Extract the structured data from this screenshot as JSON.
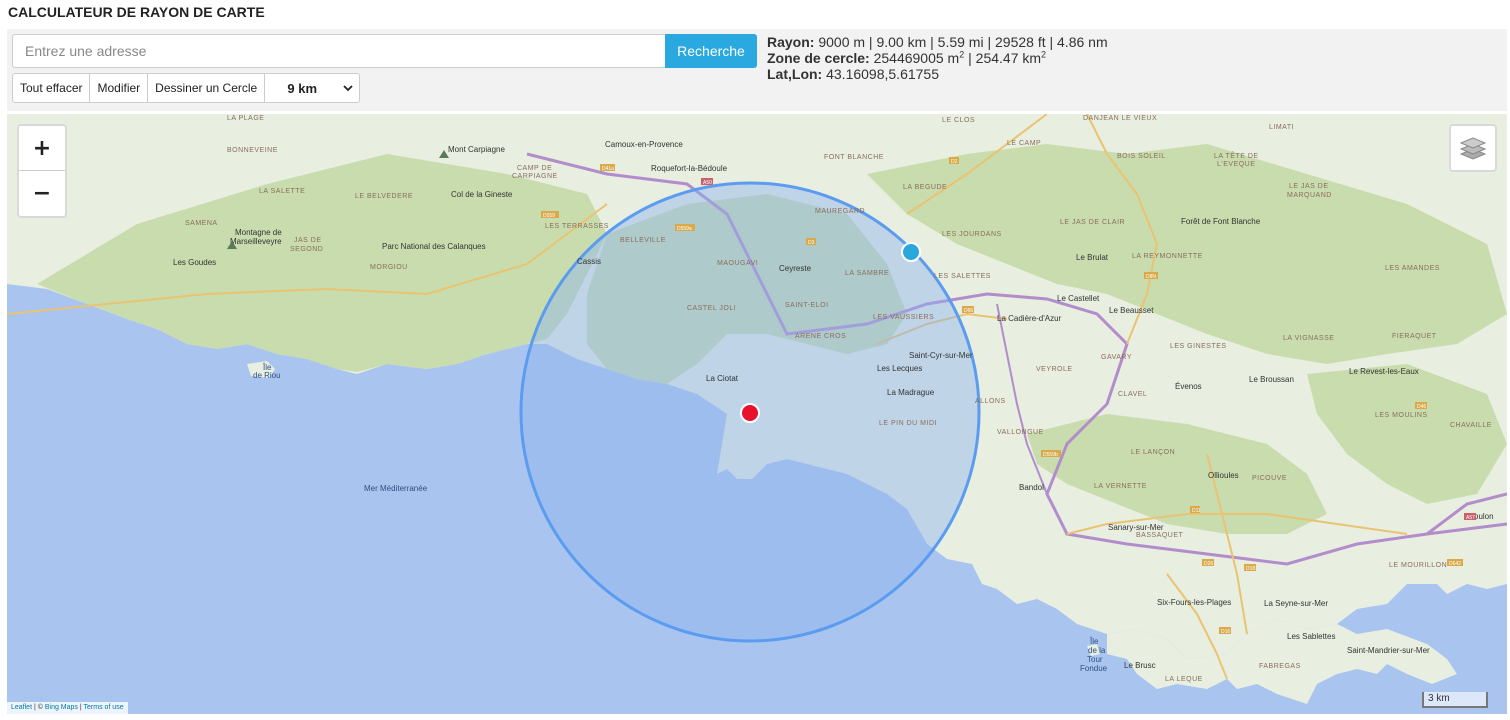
{
  "app": {
    "title": "CALCULATEUR DE RAYON DE CARTE"
  },
  "search": {
    "placeholder": "Entrez une adresse",
    "button_label": "Recherche"
  },
  "toolbar": {
    "clear_label": "Tout effacer",
    "modify_label": "Modifier",
    "draw_label": "Dessiner un Cercle",
    "radius_selected": "9 km"
  },
  "info": {
    "radius_label": "Rayon:",
    "radius_value": "9000 m | 9.00 km | 5.59 mi | 29528 ft | 4.86 nm",
    "area_label": "Zone de cercle:",
    "area_m2": "254469005 m",
    "area_sep": " | ",
    "area_km2": "254.47 km",
    "area_sup": "2",
    "latlon_label": "Lat,Lon:",
    "latlon_value": "43.16098,5.61755"
  },
  "map": {
    "zoom_in": "+",
    "zoom_out": "−",
    "attribution_leaflet": "Leaflet",
    "attribution_sep1": " | © ",
    "attribution_bing": "Bing Maps",
    "attribution_sep2": " | ",
    "attribution_terms": "Terms of use",
    "scale_label": "3 km",
    "circle_center": {
      "lat": 43.16098,
      "lon": 5.61755
    },
    "radius_m": 9000,
    "colors": {
      "sea": "#a9c5ef",
      "land": "#e8eee0",
      "park": "#c9dcae",
      "circle_fill": "#8fb3ef",
      "circle_stroke": "#5b9cf0",
      "center_marker": "#e8102d",
      "edge_marker": "#2aa7db"
    },
    "labels": {
      "camoux": "Camoux-en-Provence",
      "roquefort": "Roquefort-la-Bédoule",
      "cassis": "Cassis",
      "ceyreste": "Ceyreste",
      "la_ciotat": "La Ciotat",
      "saint_cyr": "Saint-Cyr-sur-Mer",
      "les_lecques": "Les Lecques",
      "la_madrague": "La Madrague",
      "le_castellet": "Le Castellet",
      "la_cadiere": "La Cadière-d'Azur",
      "le_beausset": "Le Beausset",
      "le_brulat": "Le Brulat",
      "bandol": "Bandol",
      "sanary": "Sanary-sur-Mer",
      "six_fours": "Six-Fours-les-Plages",
      "la_seyne": "La Seyne-sur-Mer",
      "les_sablettes": "Les Sablettes",
      "saint_mandrier": "Saint-Mandrier-sur-Mer",
      "toulon": "Toulon",
      "ollioules": "Ollioules",
      "evenos": "Évenos",
      "le_broussan": "Le Broussan",
      "revest": "Le Revest-les-Eaux",
      "le_brusc": "Le Brusc",
      "les_goudes": "Les Goudes",
      "mer": "Mer Méditerranée",
      "ile_riou_1": "Île",
      "ile_riou_2": "de Riou",
      "ile_tour_1": "Île",
      "ile_tour_2": "de la",
      "ile_tour_3": "Tour",
      "ile_tour_4": "Fondue",
      "mont_carpiagne": "Mont Carpiagne",
      "montagne_1": "Montagne de",
      "montagne_2": "Marseilleveyre",
      "col_gineste": "Col de la Gineste",
      "parc_calanques": "Parc National des Calanques",
      "foret": "Forêt de Font Blanche",
      "la_plage": "LA PLAGE",
      "bonneveine": "BONNEVEINE",
      "la_salette": "LA SALETTE",
      "le_belvedere": "LE BELVEDERE",
      "samena": "SAMENA",
      "jas_1": "JAS DE",
      "jas_2": "SEGOND",
      "morgiou": "MORGIOU",
      "camp_1": "CAMP DE",
      "camp_2": "CARPIAGNE",
      "les_terrasses": "LES TERRASSES",
      "belleville": "BELLEVILLE",
      "maougavi": "MAOUGAVI",
      "castel_joli": "CASTEL JOLI",
      "saint_eloi": "SAINT-ELOI",
      "arene_cros": "ARENE CROS",
      "la_sambre": "LA SAMBRE",
      "les_vaussiers": "LES VAUSSIERS",
      "mauregard": "MAUREGARD",
      "font_blanche": "FONT BLANCHE",
      "la_begude": "LA BEGUDE",
      "le_clos": "LE CLOS",
      "le_camp": "LE CAMP",
      "danjean": "DANJEAN LE VIEUX",
      "limati": "LIMATI",
      "bois_soleil": "BOIS SOLEIL",
      "tete_1": "LA TÊTE DE",
      "tete_2": "L'EVEQUE",
      "jas_marquand_1": "LE JAS DE",
      "jas_marquand_2": "MARQUAND",
      "les_jourdans": "LES JOURDANS",
      "le_jas_clair": "LE JAS DE CLAIR",
      "la_reymonnette": "LA REYMONNETTE",
      "les_salettes": "LES SALETTES",
      "les_amandes": "LES AMANDES",
      "fieraquet": "FIERAQUET",
      "la_vignasse": "LA VIGNASSE",
      "les_ginestes": "LES GINESTES",
      "gavary": "GAVARY",
      "veyrole": "VEYROLE",
      "clavel": "CLAVEL",
      "allons": "ALLONS",
      "vallongue": "VALLONGUE",
      "le_pin_du_midi": "LE PIN DU MIDI",
      "le_lancon": "LE LANÇON",
      "la_vernette": "LA VERNETTE",
      "picouve": "PICOUVE",
      "bassaquet": "BASSAQUET",
      "les_moulins": "LES MOULINS",
      "chavaille": "CHAVAILLE",
      "le_mourillon": "LE MOURILLON",
      "fabregas": "FABREGAS",
      "la_leque": "LA LEQUE"
    },
    "roads": [
      "A50",
      "D559",
      "D3",
      "D66",
      "D8N",
      "D2",
      "D41a",
      "D559a",
      "A57",
      "D11",
      "D26",
      "D18",
      "D16",
      "D46",
      "D642",
      "D559b"
    ]
  }
}
